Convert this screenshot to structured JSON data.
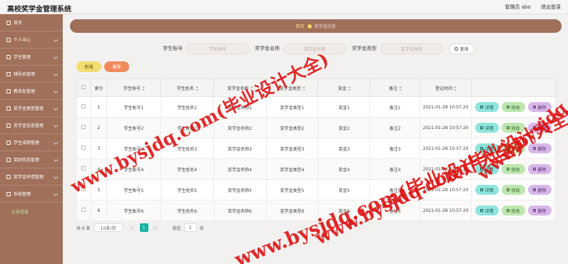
{
  "app": {
    "title": "高校奖学金管理系统",
    "user": "管理员 abo",
    "logout": "退出登录"
  },
  "sidebar": {
    "items": [
      {
        "label": "首页"
      },
      {
        "label": "个人中心"
      },
      {
        "label": "学生管理"
      },
      {
        "label": "辅导员管理"
      },
      {
        "label": "教务处管理"
      },
      {
        "label": "奖学金类型管理"
      },
      {
        "label": "奖学金信息管理"
      },
      {
        "label": "学生成绩管理"
      },
      {
        "label": "奖励信息管理"
      },
      {
        "label": "奖学金申请管理"
      },
      {
        "label": "系统管理"
      }
    ],
    "extra": "公告信息"
  },
  "breadcrumb": {
    "home": "首页",
    "current": "奖学金信息"
  },
  "search": {
    "fields": [
      {
        "label": "学生账号",
        "placeholder": "学生账号"
      },
      {
        "label": "奖学金名称",
        "placeholder": "奖学金名称"
      },
      {
        "label": "奖学金类型",
        "placeholder": "奖学金类型"
      }
    ],
    "button": "查询"
  },
  "toolbar": {
    "add": "新增",
    "delete": "删除"
  },
  "table": {
    "headers": [
      "索引",
      "学生账号",
      "学生姓名",
      "奖学金名称",
      "奖学金类型",
      "奖金",
      "备注",
      "登记时间"
    ],
    "rows": [
      [
        "1",
        "学生账号1",
        "学生姓名1",
        "奖学金名称1",
        "奖学金类型1",
        "奖金1",
        "备注1",
        "2021-01-28 10:57:20"
      ],
      [
        "2",
        "学生账号2",
        "学生姓名2",
        "奖学金名称2",
        "奖学金类型2",
        "奖金2",
        "备注2",
        "2021-01-28 10:57:20"
      ],
      [
        "3",
        "学生账号3",
        "学生姓名3",
        "奖学金名称3",
        "奖学金类型3",
        "奖金3",
        "备注3",
        "2021-01-28 10:57:20"
      ],
      [
        "4",
        "学生账号4",
        "学生姓名4",
        "奖学金名称4",
        "奖学金类型4",
        "奖金4",
        "备注4",
        "2021-01-28 10:57:20"
      ],
      [
        "5",
        "学生账号5",
        "学生姓名5",
        "奖学金名称5",
        "奖学金类型5",
        "奖金5",
        "备注5",
        "2021-01-28 10:57:20"
      ],
      [
        "6",
        "学生账号6",
        "学生姓名6",
        "奖学金名称6",
        "奖学金类型6",
        "奖金6",
        "备注6",
        "2021-01-28 10:57:20"
      ]
    ],
    "ops": {
      "detail": "详情",
      "edit": "修改",
      "delete": "删除"
    }
  },
  "pager": {
    "total": "共 6 条",
    "size": "10条/页",
    "prev": "<",
    "page": "1",
    "next": ">",
    "goto": "前往",
    "goto_value": "1",
    "unit": "页"
  },
  "watermark": "www.bysjdq.com(毕业设计大全)"
}
